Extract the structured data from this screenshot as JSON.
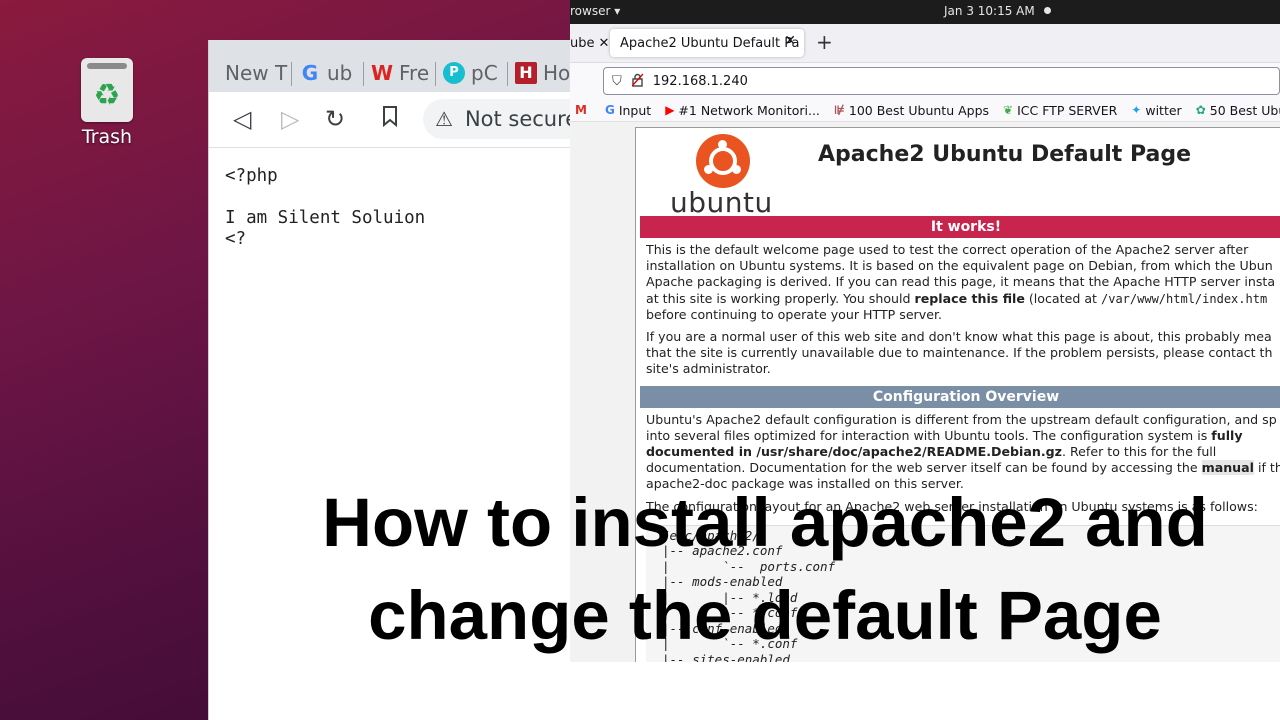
{
  "desktop": {
    "trash_label": "Trash"
  },
  "left_browser": {
    "tabs": [
      "New T",
      "ub",
      "Fre",
      "pC",
      "Ho"
    ],
    "address_warning": "Not secure",
    "content": "<?php\n\nI am Silent Soluion\n<?"
  },
  "topbar": {
    "app": "rowser ▾",
    "clock": "Jan 3  10:15 AM"
  },
  "firefox": {
    "prev_tab_label": "ube",
    "active_tab_label": "Apache2 Ubuntu Default Pa",
    "url": "192.168.1.240",
    "bookmarks": [
      "Input",
      "#1 Network Monitori...",
      "100 Best Ubuntu Apps",
      "ICC FTP SERVER",
      "witter",
      "50 Best Ubuntu A"
    ]
  },
  "apache": {
    "logo_text": "ubuntu",
    "title": "Apache2 Ubuntu Default Page",
    "banner_works": "It works!",
    "p1_l1": "This is the default welcome page used to test the correct operation of the Apache2 server after",
    "p1_l2": "installation on Ubuntu systems. It is based on the equivalent page on Debian, from which the Ubun",
    "p1_l3": "Apache packaging is derived. If you can read this page, it means that the Apache HTTP server insta",
    "p1_l4a": "at this site is working properly. You should ",
    "p1_l4b": "replace this file",
    "p1_l4c": " (located at ",
    "p1_l4d": "/var/www/html/index.htm",
    "p1_l5": "before continuing to operate your HTTP server.",
    "p2_l1": "If you are a normal user of this web site and don't know what this page is about, this probably mea",
    "p2_l2": "that the site is currently unavailable due to maintenance. If the problem persists, please contact th",
    "p2_l3": "site's administrator.",
    "banner_config": "Configuration Overview",
    "p3_l1": "Ubuntu's Apache2 default configuration is different from the upstream default configuration, and sp",
    "p3_l2a": "into several files optimized for interaction with Ubuntu tools. The configuration system is ",
    "p3_l2b": "fully",
    "p3_l3a": "documented in /usr/share/doc/apache2/README.Debian.gz",
    "p3_l3b": ". Refer to this for the full",
    "p3_l4a": "documentation. Documentation for the web server itself can be found by accessing the ",
    "p3_l4b": "manual",
    "p3_l4c": " if th",
    "p3_l5": "apache2-doc package was installed on this server.",
    "p4_l1": "The configuration layout for an Apache2 web server installation on Ubuntu systems is as follows:",
    "tree": "/etc/apache2/\n|-- apache2.conf\n|       `--  ports.conf\n|-- mods-enabled\n|       |-- *.load\n|       `-- *.conf\n|-- conf-enabled\n|       `-- *.conf\n|-- sites-enabled"
  },
  "overlay": {
    "line1": "How to install apache2 and",
    "line2": "change the default Page"
  }
}
